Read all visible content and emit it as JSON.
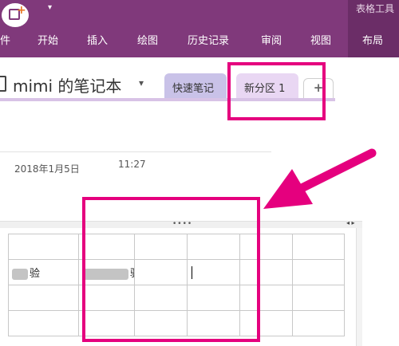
{
  "ribbon": {
    "table_tools_label": "表格工具",
    "tabs": [
      "件",
      "开始",
      "插入",
      "绘图",
      "历史记录",
      "审阅",
      "视图",
      "布局"
    ],
    "qat_caret": "▾",
    "colors": {
      "ribbon": "#80397b",
      "table_tools": "#6b2d67"
    }
  },
  "notebook": {
    "title": "mimi 的笔记本",
    "caret": "▾",
    "sections": [
      {
        "label": "快速笔记",
        "color": "#c9c2e8"
      },
      {
        "label": "新分区 1",
        "color": "#e9d7f3",
        "selected": true
      }
    ],
    "add_section_label": "+"
  },
  "page": {
    "date": "2018年1月5日",
    "time": "11:27"
  },
  "table": {
    "move_handle": "••••",
    "scroll_arrows": "◂ ▸",
    "rows": [
      [
        "",
        "",
        "",
        "",
        "",
        ""
      ],
      [
        "验",
        "验",
        "",
        "",
        "",
        ""
      ],
      [
        "",
        "",
        "",
        "",
        "",
        ""
      ],
      [
        "",
        "",
        "",
        "",
        "",
        ""
      ]
    ]
  },
  "annotation": {
    "color": "#e5007e"
  }
}
